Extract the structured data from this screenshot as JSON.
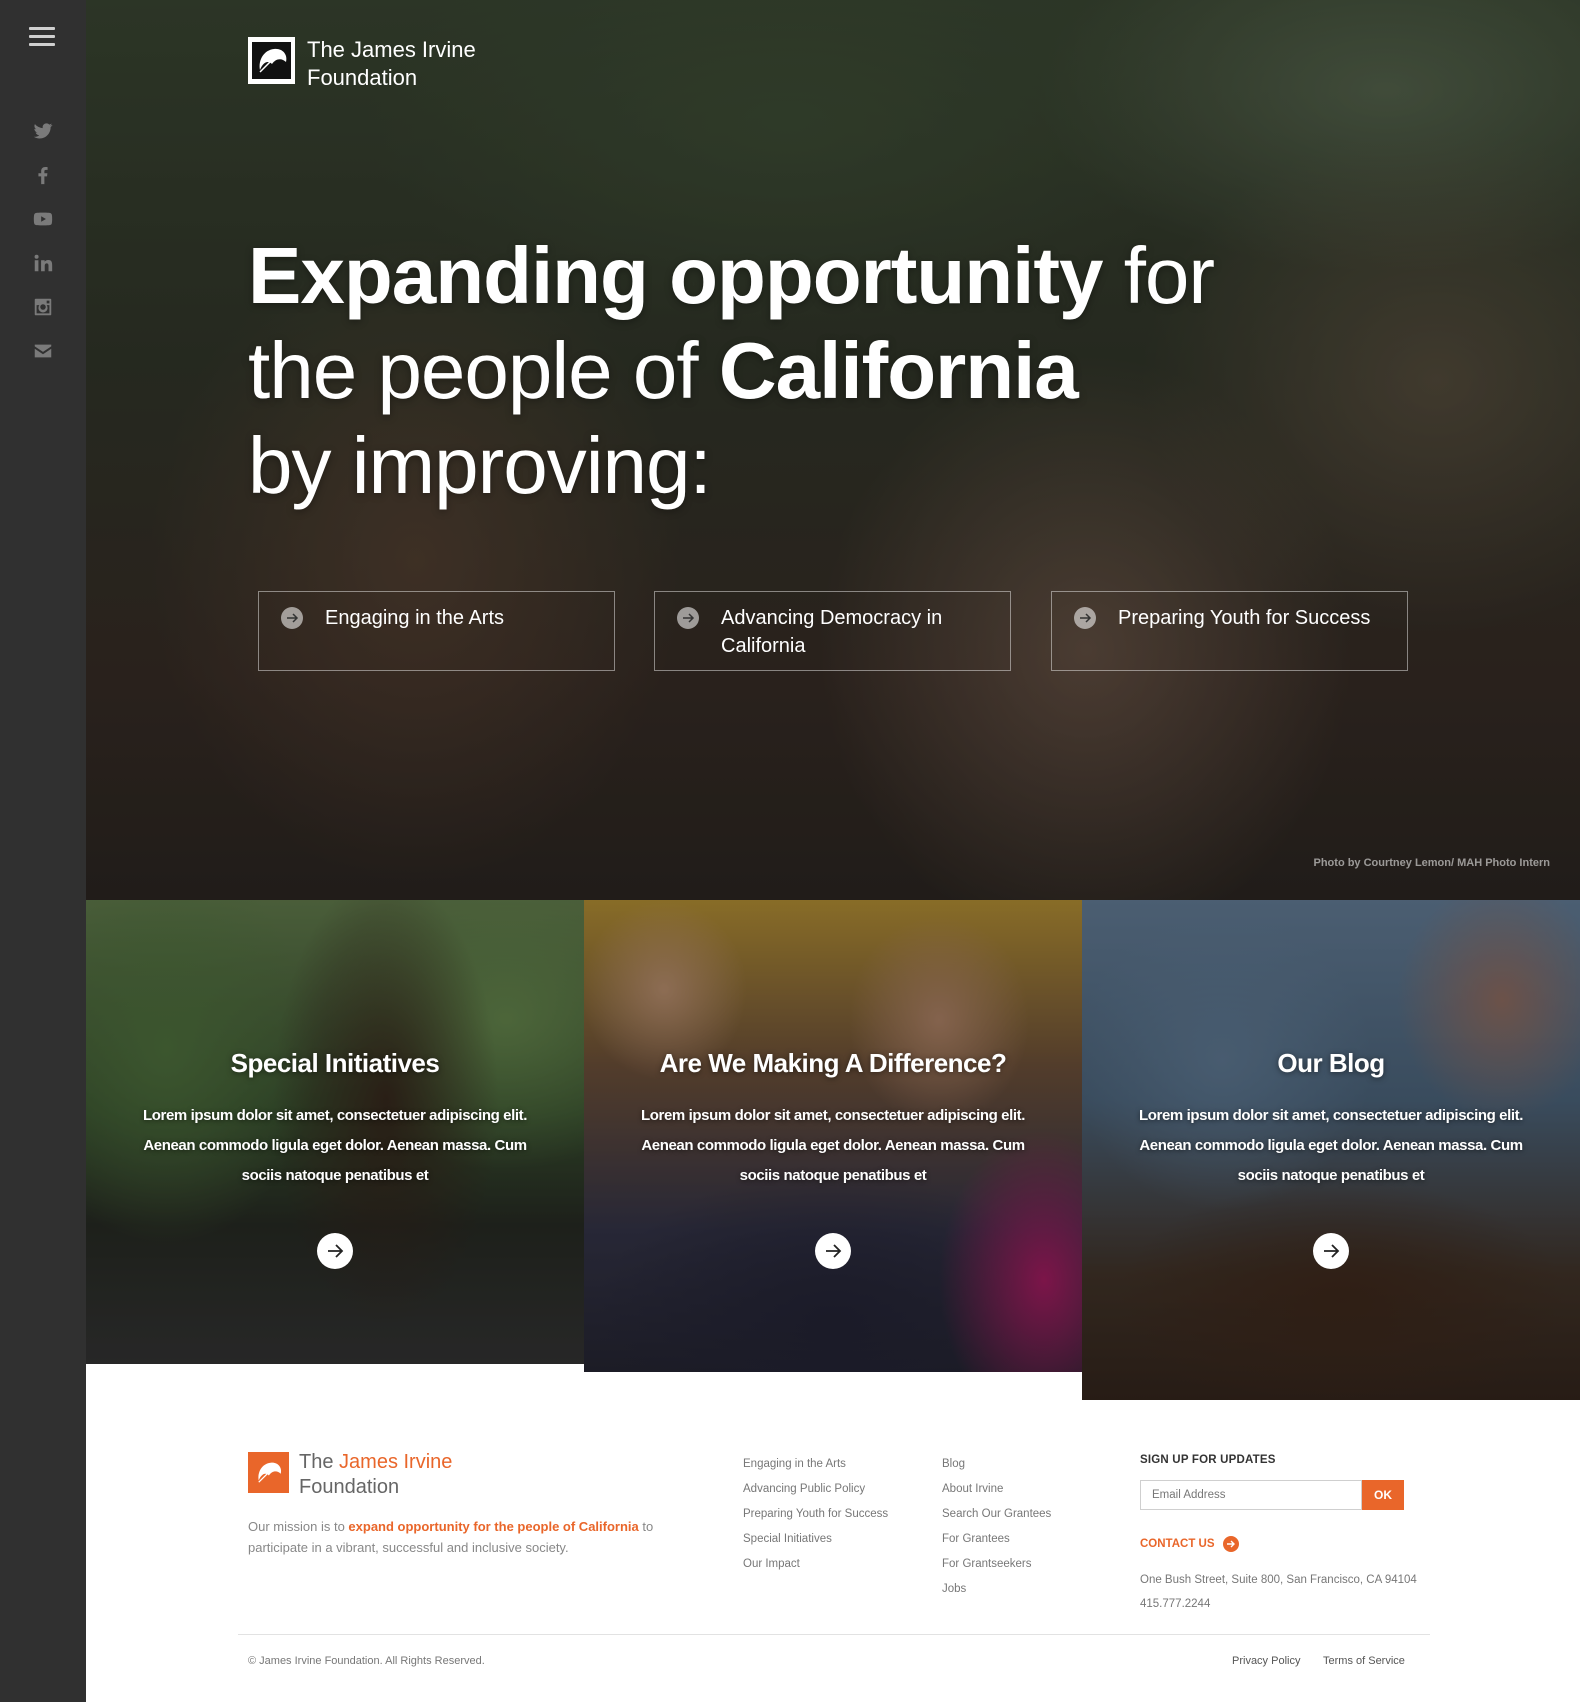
{
  "sidebar": {
    "menu_icon": "hamburger-menu-icon",
    "social": [
      "twitter-icon",
      "facebook-icon",
      "youtube-icon",
      "linkedin-icon",
      "instagram-icon",
      "email-icon"
    ]
  },
  "hero": {
    "logo": {
      "line1": "The James Irvine",
      "line2": "Foundation"
    },
    "headline": {
      "bold1": "Expanding opportunity",
      "text1": " for",
      "text2": "the people of ",
      "bold2": "California",
      "text3": "by improving:"
    },
    "focus_areas": [
      {
        "label": "Engaging in the Arts"
      },
      {
        "label": "Advancing Democracy in California"
      },
      {
        "label": "Preparing Youth for Success"
      }
    ],
    "photo_credit": "Photo by Courtney Lemon/ MAH Photo Intern"
  },
  "tiles": [
    {
      "title": "Special Initiatives",
      "body": "Lorem ipsum dolor sit amet, consectetuer adipiscing elit. Aenean commodo ligula eget dolor. Aenean massa. Cum sociis natoque penatibus et"
    },
    {
      "title": "Are We Making A Difference?",
      "body": "Lorem ipsum dolor sit amet, consectetuer adipiscing elit. Aenean commodo ligula eget dolor. Aenean massa. Cum sociis natoque penatibus et"
    },
    {
      "title": "Our Blog",
      "body": "Lorem ipsum dolor sit amet, consectetuer adipiscing elit. Aenean commodo ligula eget dolor. Aenean massa. Cum sociis natoque penatibus et"
    }
  ],
  "footer": {
    "logo": {
      "the": "The ",
      "name": "James Irvine",
      "line2": "Foundation"
    },
    "mission": {
      "pre": "Our mission is to ",
      "highlight": "expand opportunity for the people of California",
      "post": " to participate in a vibrant, successful and inclusive society."
    },
    "links_col1": [
      "Engaging in the Arts",
      "Advancing Public Policy",
      "Preparing Youth for Success",
      "Special Initiatives",
      "Our Impact"
    ],
    "links_col2": [
      "Blog",
      "About Irvine",
      "Search Our Grantees",
      "For Grantees",
      "For Grantseekers",
      "Jobs"
    ],
    "signup": {
      "title": "SIGN UP FOR UPDATES",
      "placeholder": "Email Address",
      "button": "OK"
    },
    "contact": "CONTACT US",
    "address": "One Bush Street, Suite 800, San Francisco, CA 94104",
    "phone": "415.777.2244",
    "copyright": "© James Irvine Foundation. All Rights Reserved.",
    "privacy": "Privacy Policy",
    "terms": "Terms of Service"
  },
  "colors": {
    "accent": "#e9662a",
    "sidebar": "#303030"
  }
}
